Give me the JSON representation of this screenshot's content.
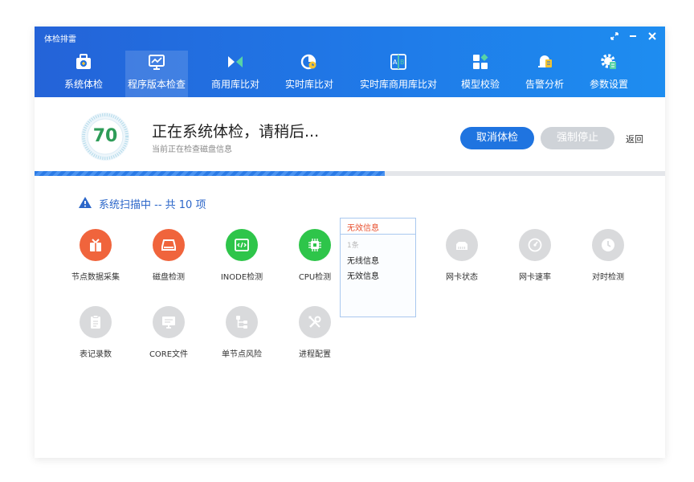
{
  "window": {
    "title": "体检排雷"
  },
  "window_controls": {
    "restore": "⤢",
    "minimize": "—",
    "close": "✕"
  },
  "nav": {
    "items": [
      {
        "label": "系统体检",
        "icon": "medkit-icon"
      },
      {
        "label": "程序版本检查",
        "icon": "monitor-chart-icon",
        "active": true
      },
      {
        "label": "商用库比对",
        "icon": "compare-arrows-icon"
      },
      {
        "label": "实时库比对",
        "icon": "pie-clock-icon"
      },
      {
        "label": "实时库商用库比对",
        "icon": "ab-compare-icon"
      },
      {
        "label": "模型校验",
        "icon": "grid-diamond-icon"
      },
      {
        "label": "告警分析",
        "icon": "bell-list-icon"
      },
      {
        "label": "参数设置",
        "icon": "gear-doc-icon"
      }
    ]
  },
  "status": {
    "score": "70",
    "main_text": "正在系统体检，请稍后...",
    "sub_text": "当前正在检查磁盘信息",
    "cancel_label": "取消体检",
    "force_stop_label": "强制停止",
    "back_label": "返回",
    "progress": 0.555
  },
  "scan": {
    "header": "系统扫描中 -- 共 10 项"
  },
  "checks": [
    {
      "label": "节点数据采集",
      "state": "error",
      "icon": "gift-box-icon"
    },
    {
      "label": "磁盘检测",
      "state": "error",
      "icon": "disk-icon"
    },
    {
      "label": "INODE检测",
      "state": "ok",
      "icon": "code-icon"
    },
    {
      "label": "CPU检测",
      "state": "ok",
      "icon": "cpu-chip-icon"
    },
    {
      "label": "网卡状态",
      "state": "pending",
      "icon": "network-card-icon"
    },
    {
      "label": "网卡速率",
      "state": "pending",
      "icon": "speedometer-icon"
    },
    {
      "label": "对时检测",
      "state": "pending",
      "icon": "clock-icon"
    },
    {
      "label": "表记录数",
      "state": "pending",
      "icon": "clipboard-icon"
    },
    {
      "label": "CORE文件",
      "state": "pending",
      "icon": "screen-icon"
    },
    {
      "label": "单节点风险",
      "state": "pending",
      "icon": "tree-nodes-icon"
    },
    {
      "label": "进程配置",
      "state": "pending",
      "icon": "wrench-tools-icon"
    }
  ],
  "popup": {
    "tab": "无效信息",
    "count": "1条",
    "lines": [
      "无线信息",
      "无效信息"
    ]
  },
  "colors": {
    "header_start": "#2463d8",
    "header_end": "#1e8df0",
    "accent": "#1f74e0",
    "error": "#f0643c",
    "ok": "#2ec54a",
    "pending": "#d9dadc"
  }
}
